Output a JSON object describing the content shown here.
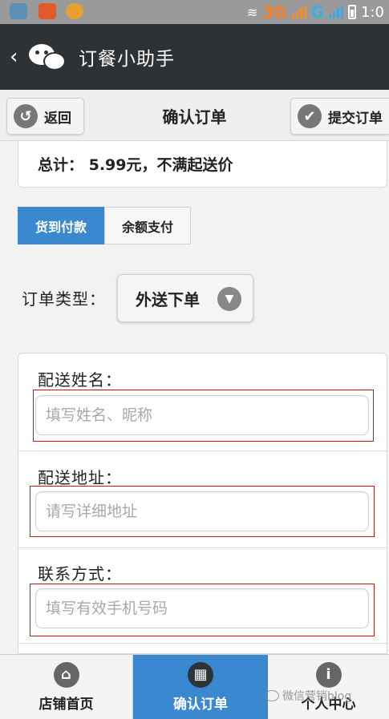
{
  "status_bar": {
    "network_primary": "3G",
    "network_secondary": "G",
    "time": "1:0"
  },
  "titlebar": {
    "title": "订餐小助手"
  },
  "header": {
    "back_label": "返回",
    "title": "确认订单",
    "submit_label": "提交订单"
  },
  "summary": {
    "total_text": "总计：  5.99元，不满起送价"
  },
  "payment": {
    "options": [
      "货到付款",
      "余额支付"
    ],
    "selected": "货到付款"
  },
  "order_type": {
    "label": "订单类型：",
    "value": "外送下单"
  },
  "form": {
    "fields": [
      {
        "label": "配送姓名：",
        "placeholder": "填写姓名、昵称",
        "value": ""
      },
      {
        "label": "配送地址：",
        "placeholder": "请写详细地址",
        "value": ""
      },
      {
        "label": "联系方式：",
        "placeholder": "填写有效手机号码",
        "value": ""
      }
    ]
  },
  "bottom_nav": {
    "items": [
      "店铺首页",
      "确认订单",
      "个人中心"
    ],
    "active": "确认订单"
  },
  "watermark": "微信营销blog",
  "colors": {
    "accent": "#3a88d0",
    "titlebar": "#2f3234",
    "annotation": "#c11c1c"
  },
  "icons": [
    "back-arrow-icon",
    "check-icon",
    "chevron-down-icon",
    "home-icon",
    "grid-icon",
    "info-icon",
    "wechat-logo-icon"
  ]
}
